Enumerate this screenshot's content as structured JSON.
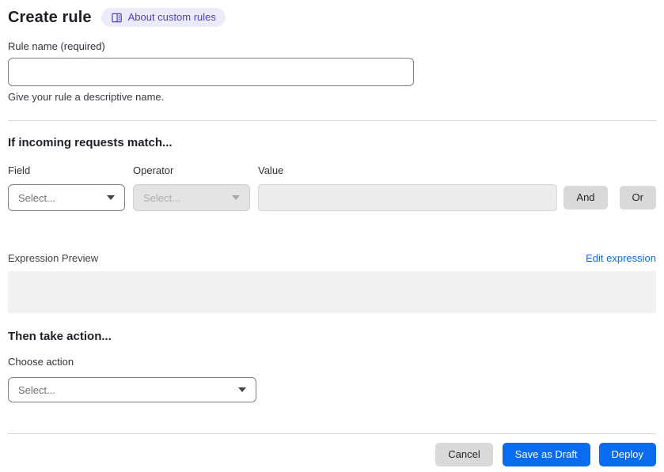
{
  "header": {
    "title": "Create rule",
    "badge_label": "About custom rules"
  },
  "rule_name": {
    "label": "Rule name (required)",
    "value": "",
    "help": "Give your rule a descriptive name."
  },
  "match_section": {
    "heading": "If incoming requests match...",
    "field": {
      "label": "Field",
      "placeholder": "Select..."
    },
    "operator": {
      "label": "Operator",
      "placeholder": "Select..."
    },
    "value": {
      "label": "Value",
      "value": ""
    },
    "and_label": "And",
    "or_label": "Or",
    "expression_preview_label": "Expression Preview",
    "edit_expression_label": "Edit expression",
    "expression_value": ""
  },
  "action_section": {
    "heading": "Then take action...",
    "choose_action_label": "Choose action",
    "placeholder": "Select..."
  },
  "footer": {
    "cancel_label": "Cancel",
    "save_draft_label": "Save as Draft",
    "deploy_label": "Deploy"
  },
  "colors": {
    "primary_blue": "#086bf0",
    "link_blue": "#086bf0",
    "badge_bg": "#ecebfa",
    "badge_text": "#4a43c5",
    "secondary_gray": "#d9d9d9",
    "disabled_bg": "#e4e4e4",
    "preview_bg": "#f1f1f1"
  }
}
